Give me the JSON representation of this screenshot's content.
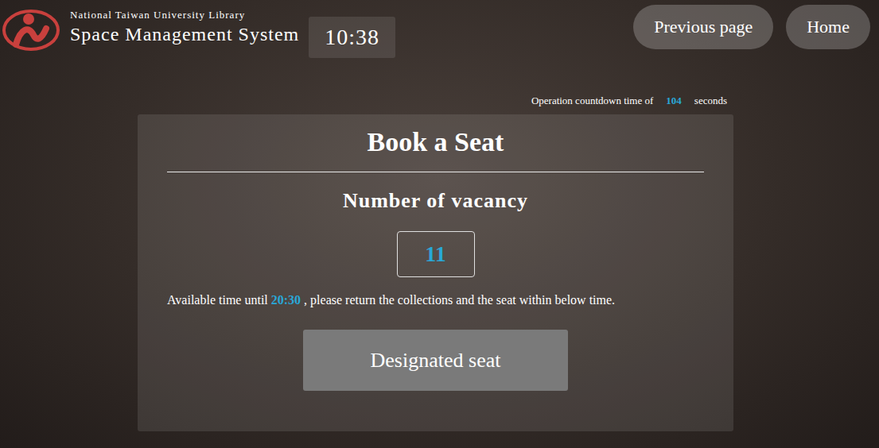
{
  "header": {
    "institution": "National Taiwan University Library",
    "system": "Space Management System",
    "clock": "10:38"
  },
  "nav_buttons": [
    "Previous page",
    "Home"
  ],
  "countdown": {
    "prefix": "Operation countdown time of",
    "seconds": "104",
    "suffix": "seconds"
  },
  "card": {
    "title": "Book a Seat",
    "vacancy_label": "Number of vacancy",
    "vacancy": "11",
    "notice_prefix": "Available time until",
    "until": "20:30",
    "notice_suffix": ", please return the collections and the seat within below time.",
    "button": "Designated seat"
  }
}
